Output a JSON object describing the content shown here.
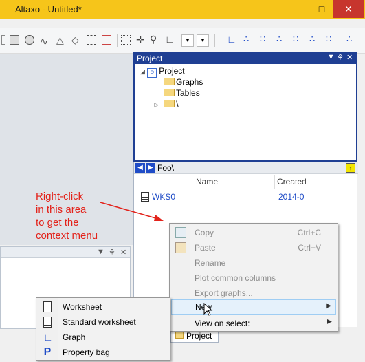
{
  "window": {
    "title": "Altaxo - Untitled*",
    "min_icon": "minimize-icon",
    "max_icon": "maximize-icon",
    "close_icon": "close-icon",
    "accent_color": "#f6c51a"
  },
  "toolbar": {
    "icons": [
      "rectangle-icon",
      "ellipse-icon",
      "curve-icon",
      "triangle-icon",
      "shape-icon",
      "shape2-icon",
      "group-icon",
      "grid-icon",
      "crosshair-icon",
      "zoom-icon",
      "axis-icon",
      "dropdown-icon",
      "dropdown-icon",
      "line-plot-icon",
      "scatter-plot-icon",
      "scatter-plot2-icon",
      "scatter-plot3-icon",
      "scatter-plot4-icon",
      "scatter-plot5-icon",
      "scatter-plot6-icon"
    ]
  },
  "project_pane": {
    "title": "Project",
    "header_color": "#1f3f93",
    "tree": {
      "root": "Project",
      "children": [
        "Graphs",
        "Tables",
        "\\"
      ]
    }
  },
  "list_pane": {
    "path": "Foo\\",
    "columns": [
      "Name",
      "Created"
    ],
    "rows": [
      {
        "name": "WKS0",
        "created": "2014-0"
      }
    ]
  },
  "bottom_tab": "Project",
  "annotation": {
    "lines": [
      "Right-click",
      "in this area",
      "to get the",
      "context menu"
    ],
    "color": "#e3231b"
  },
  "context_menu": {
    "items": [
      {
        "label": "Copy",
        "shortcut": "Ctrl+C",
        "icon": "copy-icon",
        "disabled": true
      },
      {
        "label": "Paste",
        "shortcut": "Ctrl+V",
        "icon": "paste-icon",
        "disabled": true
      },
      {
        "label": "Rename",
        "shortcut": "",
        "disabled": true
      },
      {
        "label": "Plot common columns",
        "shortcut": "",
        "disabled": true
      },
      {
        "label": "Export graphs...",
        "shortcut": "",
        "disabled": true
      },
      {
        "label": "New",
        "shortcut": "",
        "submenu": true
      },
      {
        "label": "View on select:",
        "shortcut": "",
        "submenu": true
      }
    ]
  },
  "submenu": {
    "items": [
      {
        "label": "Worksheet",
        "icon": "worksheet-icon"
      },
      {
        "label": "Standard worksheet",
        "icon": "standard-worksheet-icon"
      },
      {
        "label": "Graph",
        "icon": "graph-icon"
      },
      {
        "label": "Property bag",
        "icon": "property-bag-icon"
      }
    ]
  }
}
